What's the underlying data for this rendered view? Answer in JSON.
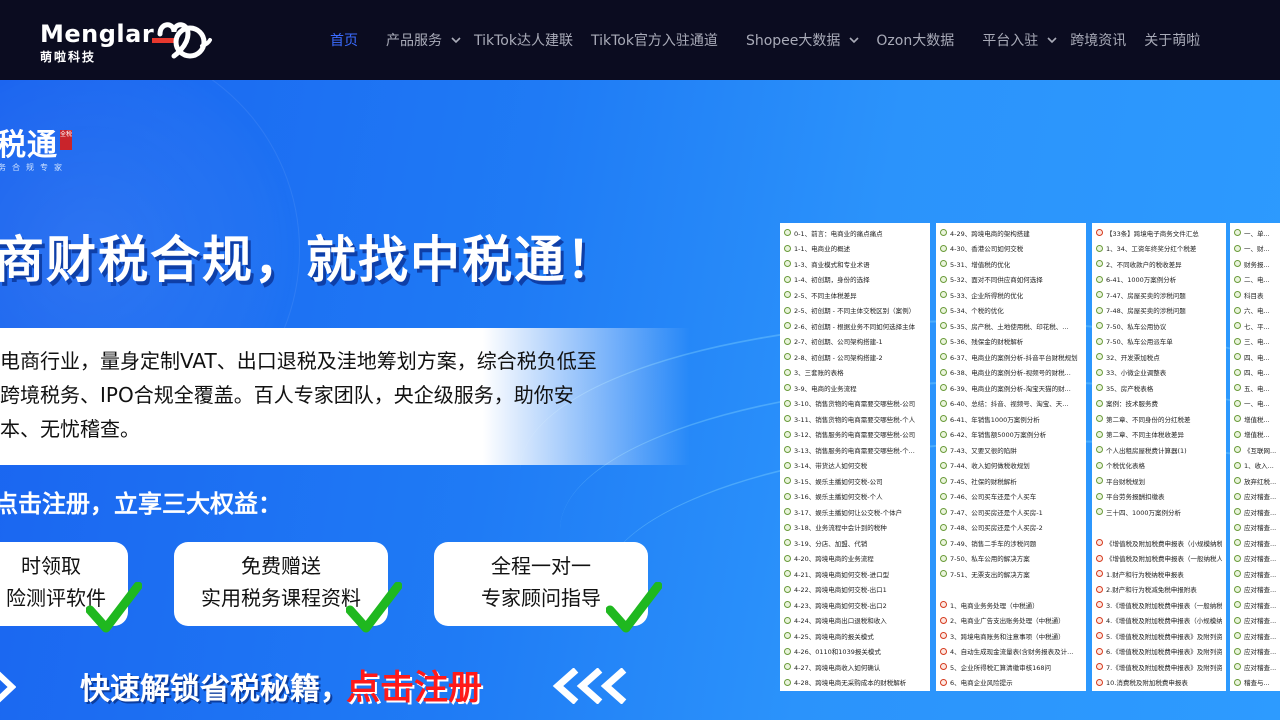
{
  "header": {
    "logo_text": "Menglar",
    "logo_sub": "萌啦科技",
    "nav": [
      {
        "label": "首页",
        "active": true,
        "dropdown": false
      },
      {
        "label": "产品服务",
        "active": false,
        "dropdown": true
      },
      {
        "label": "TikTok达人建联",
        "active": false,
        "dropdown": false
      },
      {
        "label": "TikTok官方入驻通道",
        "active": false,
        "dropdown": false
      },
      {
        "label": "Shopee大数据",
        "active": false,
        "dropdown": true
      },
      {
        "label": "Ozon大数据",
        "active": false,
        "dropdown": false
      },
      {
        "label": "平台入驻",
        "active": false,
        "dropdown": true
      },
      {
        "label": "跨境资讯",
        "active": false,
        "dropdown": false
      },
      {
        "label": "关于萌啦",
        "active": false,
        "dropdown": false
      }
    ]
  },
  "banner": {
    "brand": "税通",
    "brand_seal": "全税",
    "brand_tagline": "务合规专家",
    "headline": "商财税合规，就找中税通！",
    "desc_lines": [
      "电商行业，量身定制VAT、出口退税及洼地筹划方案，综合税负低至",
      "跨境税务、IPO合规全覆盖。百人专家团队，央企级服务，助你安",
      "本、无忧稽查。"
    ],
    "cta_title": "点击注册，立享三大权益：",
    "cards": [
      {
        "line1": "时领取",
        "line2": "险测评软件"
      },
      {
        "line1": "免费赠送",
        "line2": "实用税务课程资料"
      },
      {
        "line1": "全程一对一",
        "line2": "专家顾问指导"
      }
    ],
    "unlock_text": "快速解锁省税秘籍，",
    "unlock_cta": "点击注册"
  },
  "doc_panels": [
    [
      "0-1、前言：电商业的痛点痛点",
      "1-1、电商业的概述",
      "1-3、商业模式和专业术语",
      "1-4、初创期，身份的选择",
      "2-5、不同主体税差异",
      "2-5、初创期 - 不同主体交税区别（案例）",
      "2-6、初创期 - 根据业务不同如何选择主体",
      "2-7、初创期、公司架构搭建-1",
      "2-8、初创期 - 公司架构搭建-2",
      "3、三套账的表格",
      "3-9、电商的业务流程",
      "3-10、销售货物的电商需要交哪些税-公司",
      "3-11、销售货物的电商需要交哪些税-个人",
      "3-12、销售服务的电商需要交哪些税-公司",
      "3-13、销售服务的电商需要交哪些税-个...",
      "3-14、带货达人如何交税",
      "3-15、娱乐主播如何交税-公司",
      "3-16、娱乐主播如何交税-个人",
      "3-17、娱乐主播如何让公交税-个体户",
      "3-18、业务流程中会计到的税种",
      "3-19、分店、加盟、代销",
      "4-20、跨境电商的业务流程",
      "4-21、跨境电商如何交税-进口型",
      "4-22、跨境电商如何交税-出口1",
      "4-23、跨境电商如何交税-出口2",
      "4-24、跨境电商出口退税和收入",
      "4-25、跨境电商的报关模式",
      "4-26、0110和1039报关模式",
      "4-27、跨境电商收入如何确认",
      "4-28、跨境电商无采购成本的财税解析"
    ],
    [
      "4-29、跨境电商的架构搭建",
      "4-30、香港公司如何交税",
      "5-31、增值税的优化",
      "5-32、面对不同供应商如何选择",
      "5-33、企业所得税的优化",
      "5-34、个税的优化",
      "5-35、房产税、土地使用税、印花税、...",
      "5-36、残保金的财税解析",
      "6-37、电商业的案例分析-抖音平台财税规划",
      "6-38、电商业的案例分析-视频号的财税...",
      "6-39、电商业的案例分析-淘宝天猫的财...",
      "6-40、总结：抖音、视频号、淘宝、天...",
      "6-41、年销售1000万案例分析",
      "6-42、年销售额5000万案例分析",
      "7-43、又要又很的陷阱",
      "7-44、收入如何做税收规划",
      "7-45、社保的财税解析",
      "7-46、公司买车还是个人买车",
      "7-47、公司买房还是个人买房-1",
      "7-48、公司买房还是个人买房-2",
      "7-49、销售二手车的涉税问题",
      "7-50、私车公用的解决方案",
      "7-51、无票支出的解决方案",
      "",
      "1、电商业务务处理（中税通）",
      "2、电商业广告支出账务处理（中税通）",
      "3、跨境电商账务和注意事项（中税通）",
      "4、自动生成现金流量表(含财务报表及计...",
      "5、企业所得税汇算清缴审核168问",
      "6、电商企业风险提示"
    ],
    [
      "【33条】跨境电子商务文件汇总",
      "1、34、工资年终奖分红个税差",
      "2、不同收款户的税收差异",
      "6-41、1000万案例分析",
      "7-47、房屋买卖的涉税问题",
      "7-48、房屋买卖的涉税问题",
      "7-50、私车公用协议",
      "7-50、私车公用派车单",
      "32、开发票加税点",
      "33、小微企业调整表",
      "35、房产税表格",
      "案例：技术服务费",
      "第二章、不同身份的分红税差",
      "第二章、不同主体税收差异",
      "个人出租房屋税费计算器(1)",
      "个税优化表格",
      "平台财税规划",
      "平台劳务报酬扣缴表",
      "三十四、1000万案例分析",
      "",
      "《增值税及附加税费申报表（小规模纳税...",
      "《增值税及附加税费申报表（一般纳税人...",
      "1.财产和行为税纳税申报表",
      "2.财产和行为税减免税申报附表",
      "3.《增值税及附加税费申报表（一般纳税...",
      "4.《增值税及附加税费申报表（小规模纳...",
      "5.《增值税及附加税费申报表》及附列资...",
      "6.《增值税及附加税费申报表》及附列资...",
      "7.《增值税及附加税费申报表》及附列资...",
      "10.消费税及附加税费申报表"
    ],
    [
      "一、单...",
      "一、财...",
      "财务报...",
      "二、电...",
      "科目表",
      "六、电...",
      "七、平...",
      "三、电...",
      "四、电...",
      "四、电...",
      "五、电...",
      "一、电...",
      "增值税...",
      "增值税...",
      "《互联网...",
      "1、收入...",
      "放弃红税...",
      "应对稽查...",
      "应对稽查...",
      "应对稽查...",
      "应对稽查...",
      "应对稽查...",
      "应对稽查...",
      "应对稽查...",
      "应对稽查...",
      "应对稽查...",
      "应对稽查...",
      "应对稽查...",
      "应对稽查...",
      "稽查与..."
    ]
  ],
  "colors": {
    "header_bg": "#0b0c20",
    "nav_active": "#3b6cff",
    "nav_text": "#a9abb8",
    "banner_blue": "#1f7bf5",
    "cta_red": "#ff1a1a",
    "check_green": "#1fb81f"
  }
}
